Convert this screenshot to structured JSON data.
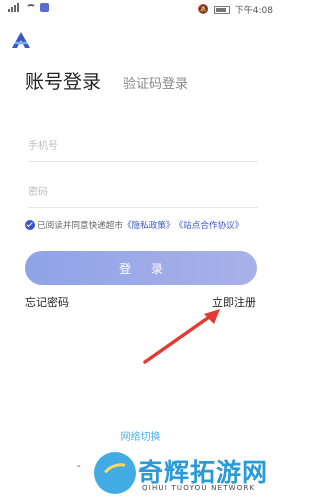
{
  "status_bar": {
    "time": "下午4:08"
  },
  "tabs": {
    "account_login": "账号登录",
    "code_login": "验证码登录"
  },
  "form": {
    "phone_placeholder": "手机号",
    "password_placeholder": "密码"
  },
  "agreement": {
    "prefix": "已阅读并同意快递超市",
    "privacy_link": "《隐私政策》",
    "coop_link": "《站点合作协议》"
  },
  "login_button": "登 录",
  "links": {
    "forgot": "忘记密码",
    "register": "立即注册"
  },
  "network_switch": "网络切换",
  "watermark": {
    "title": "奇辉拓游网",
    "subtitle": "QIHUI TUOYOU NETWORK",
    "dash": "-"
  },
  "colors": {
    "accent": "#3b55c6",
    "button": "#9aa9e8",
    "arrow": "#e53935",
    "link_blue": "#4ab1e6"
  }
}
